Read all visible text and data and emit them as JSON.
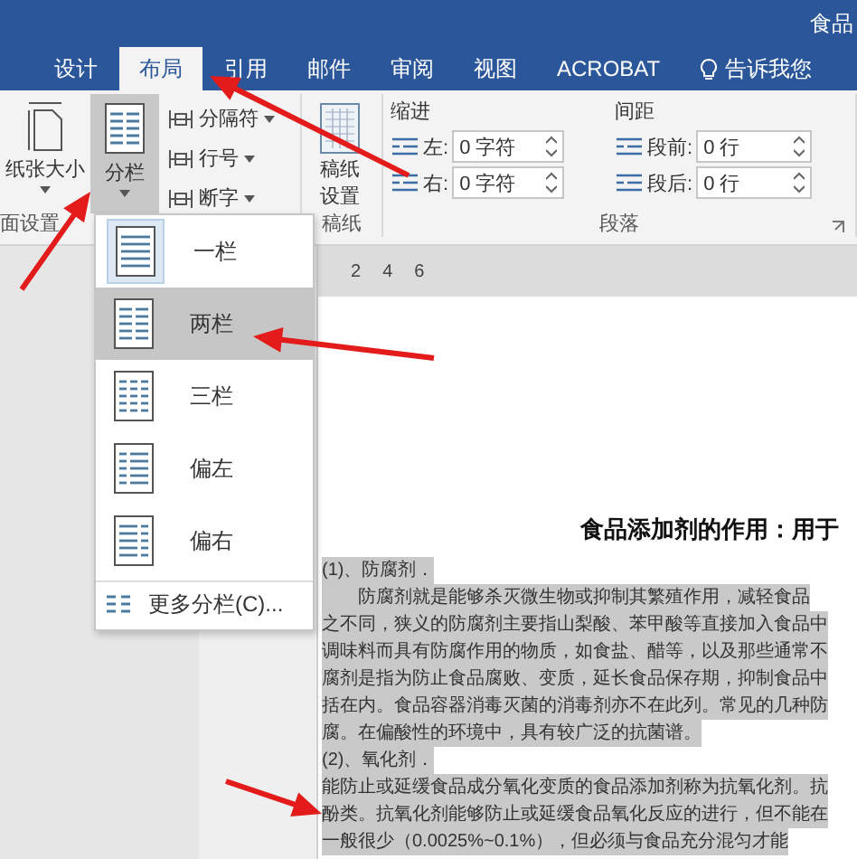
{
  "title": "食品",
  "tabs": [
    {
      "label": "设计",
      "selected": false
    },
    {
      "label": "布局",
      "selected": true
    },
    {
      "label": "引用",
      "selected": false
    },
    {
      "label": "邮件",
      "selected": false
    },
    {
      "label": "审阅",
      "selected": false
    },
    {
      "label": "视图",
      "selected": false
    },
    {
      "label": "ACROBAT",
      "selected": false
    }
  ],
  "tell_me": "告诉我您",
  "ribbon": {
    "size_label": "纸张大小",
    "columns_button": {
      "label": "分栏",
      "pressed": true
    },
    "small_buttons": [
      "分隔符",
      "行号",
      "断字"
    ],
    "manuscript": [
      "稿纸",
      "设置"
    ],
    "indent": {
      "title": "缩进",
      "fields": [
        {
          "label": "左:",
          "value": "0 字符"
        },
        {
          "label": "右:",
          "value": "0 字符"
        }
      ]
    },
    "spacing": {
      "title": "间距",
      "fields": [
        {
          "label": "段前:",
          "value": "0 行"
        },
        {
          "label": "段后:",
          "value": "0 行"
        }
      ]
    },
    "group_labels": [
      "面设置",
      "稿纸",
      "段落"
    ]
  },
  "menu": {
    "items": [
      {
        "kind": "one",
        "label": "一栏",
        "current": true,
        "selected": false
      },
      {
        "kind": "two",
        "label": "两栏",
        "current": false,
        "selected": true
      },
      {
        "kind": "three",
        "label": "三栏",
        "current": false,
        "selected": false
      },
      {
        "kind": "left",
        "label": "偏左",
        "current": false,
        "selected": false
      },
      {
        "kind": "right",
        "label": "偏右",
        "current": false,
        "selected": false
      }
    ],
    "more": "更多分栏(C)..."
  },
  "ruler": [
    "2",
    "4",
    "6"
  ],
  "document": {
    "heading": "食品添加剂的作用：用于",
    "lines": [
      {
        "text": "(1)、防腐剂．",
        "highlighted": true
      },
      {
        "text": "　　防腐剂就是能够杀灭微生物或抑制其繁殖作用，减轻食品",
        "highlighted": true
      },
      {
        "text": "之不同，狭义的防腐剂主要指山梨酸、苯甲酸等直接加入食品中",
        "highlighted": true
      },
      {
        "text": "调味料而具有防腐作用的物质，如食盐、醋等，以及那些通常不",
        "highlighted": true
      },
      {
        "text": "腐剂是指为防止食品腐败、变质，延长食品保存期，抑制食品中",
        "highlighted": true
      },
      {
        "text": "括在内。食品容器消毒灭菌的消毒剂亦不在此列。常见的几种防",
        "highlighted": true
      },
      {
        "text": "腐。在偏酸性的环境中，具有较广泛的抗菌谱。",
        "highlighted": true
      },
      {
        "text": "(2)、氧化剂．",
        "highlighted": true
      },
      {
        "text": "能防止或延缓食品成分氧化变质的食品添加剂称为抗氧化剂。抗",
        "highlighted": true
      },
      {
        "text": "酚类。抗氧化剂能够防止或延缓食品氧化反应的进行，但不能在",
        "highlighted": true
      },
      {
        "text": "一般很少（0.0025%~0.1%），但必须与食品充分混匀才能",
        "highlighted": true
      }
    ]
  }
}
